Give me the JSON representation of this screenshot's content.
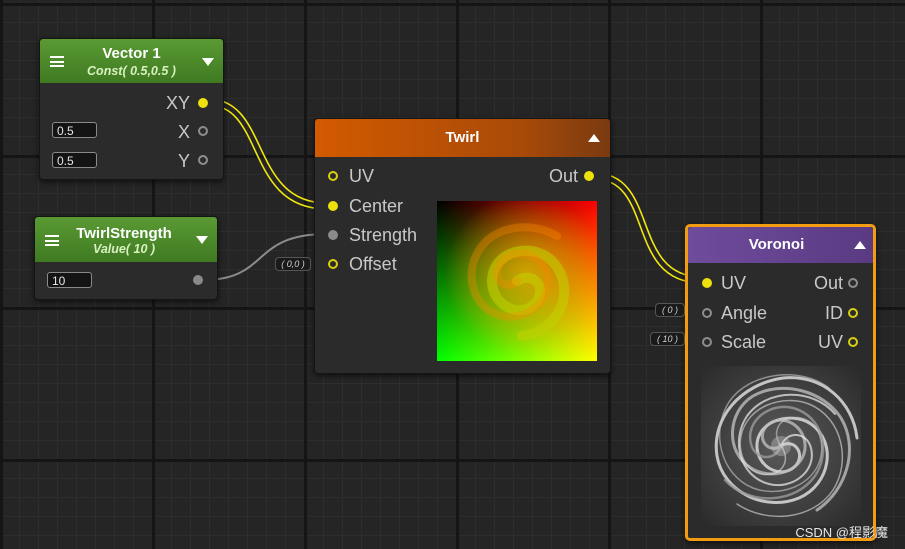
{
  "colors": {
    "wire_vector": "#f1e60d",
    "wire_float": "#8c8c8c",
    "vector_header": "#4e8a2a",
    "twirl_header": "#c75400",
    "voronoi_header": "#6a4896",
    "selection": "#f39c12"
  },
  "nodes": {
    "vector1": {
      "title": "Vector 1",
      "subtitle": "Const( 0.5,0.5 )",
      "outputs": [
        "XY",
        "X",
        "Y"
      ],
      "x_value": "0.5",
      "y_value": "0.5"
    },
    "twirlstrength": {
      "title": "TwirlStrength",
      "subtitle": "Value( 10 )",
      "value": "10"
    },
    "twirl": {
      "title": "Twirl",
      "inputs": [
        "UV",
        "Center",
        "Strength",
        "Offset"
      ],
      "output": "Out",
      "offset_default": "( 0,0 )"
    },
    "voronoi": {
      "title": "Voronoi",
      "inputs": [
        "UV",
        "Angle",
        "Scale"
      ],
      "outputs": [
        "Out",
        "ID",
        "UV"
      ],
      "angle_default": "( 0 )",
      "scale_default": "( 10 )"
    }
  },
  "watermark": "CSDN @程影魔"
}
